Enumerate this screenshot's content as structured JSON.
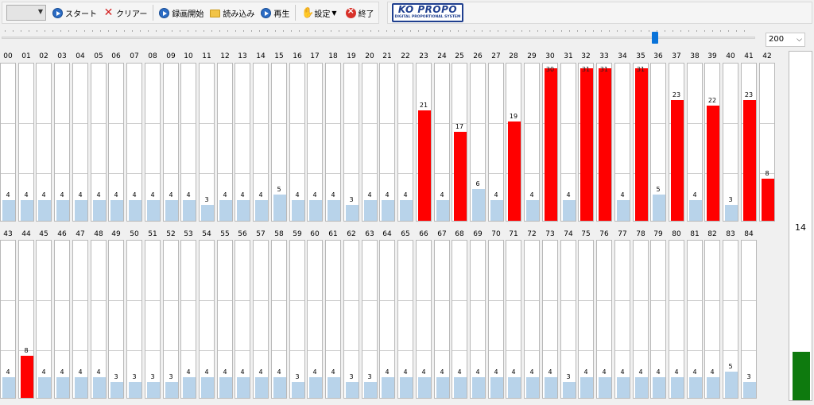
{
  "toolbar": {
    "combo_value": "",
    "start_label": "スタート",
    "clear_label": "クリアー",
    "record_label": "録画開始",
    "load_label": "読み込み",
    "play_label": "再生",
    "settings_label": "設定",
    "exit_label": "終了"
  },
  "logo": {
    "main": "KO PROPO",
    "sub": "DIGITAL PROPORTIONAL SYSTEM"
  },
  "zoom": {
    "value": "200"
  },
  "colors": {
    "over": "#ff0000",
    "normal": "#b8d3ea",
    "meter": "#0e7a0e"
  },
  "scale": {
    "max": 30
  },
  "rows": [
    {
      "channels": [
        {
          "label": "00",
          "value": 4
        },
        {
          "label": "01",
          "value": 4
        },
        {
          "label": "02",
          "value": 4
        },
        {
          "label": "03",
          "value": 4
        },
        {
          "label": "04",
          "value": 4
        },
        {
          "label": "05",
          "value": 4
        },
        {
          "label": "06",
          "value": 4
        },
        {
          "label": "07",
          "value": 4
        },
        {
          "label": "08",
          "value": 4
        },
        {
          "label": "09",
          "value": 4
        },
        {
          "label": "10",
          "value": 4
        },
        {
          "label": "11",
          "value": 3
        },
        {
          "label": "12",
          "value": 4
        },
        {
          "label": "13",
          "value": 4
        },
        {
          "label": "14",
          "value": 4
        },
        {
          "label": "15",
          "value": 5
        },
        {
          "label": "16",
          "value": 4
        },
        {
          "label": "17",
          "value": 4
        },
        {
          "label": "18",
          "value": 4
        },
        {
          "label": "19",
          "value": 3
        },
        {
          "label": "20",
          "value": 4
        },
        {
          "label": "21",
          "value": 4
        },
        {
          "label": "22",
          "value": 4
        },
        {
          "label": "23",
          "value": 21
        },
        {
          "label": "24",
          "value": 4
        },
        {
          "label": "25",
          "value": 17
        },
        {
          "label": "26",
          "value": 6
        },
        {
          "label": "27",
          "value": 4
        },
        {
          "label": "28",
          "value": 19
        },
        {
          "label": "29",
          "value": 4
        },
        {
          "label": "30",
          "value": 30
        },
        {
          "label": "31",
          "value": 4
        },
        {
          "label": "32",
          "value": 31
        },
        {
          "label": "33",
          "value": 31
        },
        {
          "label": "34",
          "value": 4
        },
        {
          "label": "35",
          "value": 31
        },
        {
          "label": "36",
          "value": 5
        },
        {
          "label": "37",
          "value": 23
        },
        {
          "label": "38",
          "value": 4
        },
        {
          "label": "39",
          "value": 22
        },
        {
          "label": "40",
          "value": 3
        },
        {
          "label": "41",
          "value": 23
        },
        {
          "label": "42",
          "value": 8
        }
      ]
    },
    {
      "channels": [
        {
          "label": "43",
          "value": 4
        },
        {
          "label": "44",
          "value": 8
        },
        {
          "label": "45",
          "value": 4
        },
        {
          "label": "46",
          "value": 4
        },
        {
          "label": "47",
          "value": 4
        },
        {
          "label": "48",
          "value": 4
        },
        {
          "label": "49",
          "value": 3
        },
        {
          "label": "50",
          "value": 3
        },
        {
          "label": "51",
          "value": 3
        },
        {
          "label": "52",
          "value": 3
        },
        {
          "label": "53",
          "value": 4
        },
        {
          "label": "54",
          "value": 4
        },
        {
          "label": "55",
          "value": 4
        },
        {
          "label": "56",
          "value": 4
        },
        {
          "label": "57",
          "value": 4
        },
        {
          "label": "58",
          "value": 4
        },
        {
          "label": "59",
          "value": 3
        },
        {
          "label": "60",
          "value": 4
        },
        {
          "label": "61",
          "value": 4
        },
        {
          "label": "62",
          "value": 3
        },
        {
          "label": "63",
          "value": 3
        },
        {
          "label": "64",
          "value": 4
        },
        {
          "label": "65",
          "value": 4
        },
        {
          "label": "66",
          "value": 4
        },
        {
          "label": "67",
          "value": 4
        },
        {
          "label": "68",
          "value": 4
        },
        {
          "label": "69",
          "value": 4
        },
        {
          "label": "70",
          "value": 4
        },
        {
          "label": "71",
          "value": 4
        },
        {
          "label": "72",
          "value": 4
        },
        {
          "label": "73",
          "value": 4
        },
        {
          "label": "74",
          "value": 3
        },
        {
          "label": "75",
          "value": 4
        },
        {
          "label": "76",
          "value": 4
        },
        {
          "label": "77",
          "value": 4
        },
        {
          "label": "78",
          "value": 4
        },
        {
          "label": "79",
          "value": 4
        },
        {
          "label": "80",
          "value": 4
        },
        {
          "label": "81",
          "value": 4
        },
        {
          "label": "82",
          "value": 4
        },
        {
          "label": "83",
          "value": 5
        },
        {
          "label": "84",
          "value": 3
        }
      ]
    }
  ],
  "meter": {
    "value": "14",
    "level": 0.14
  }
}
